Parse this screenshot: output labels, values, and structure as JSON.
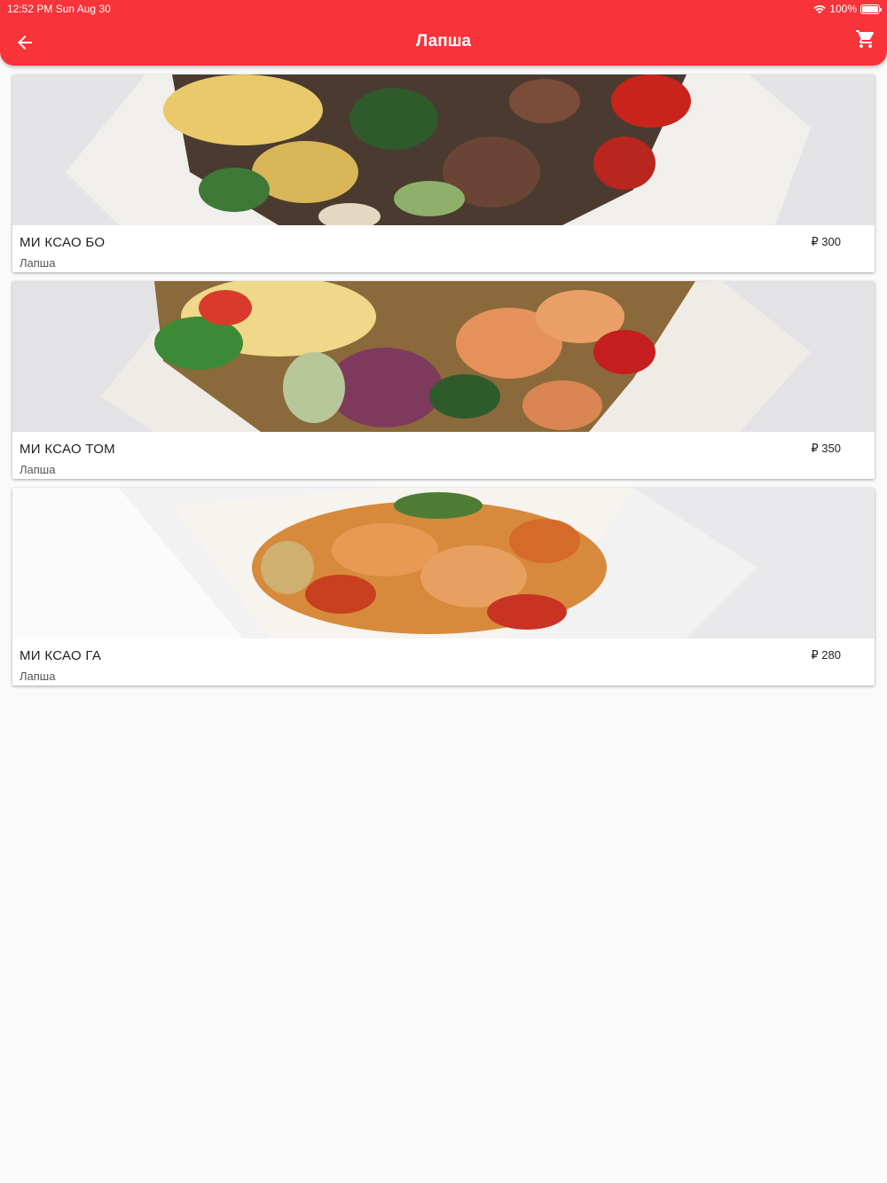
{
  "status_bar": {
    "time": "12:52 PM   Sun Aug 30",
    "battery": "100%"
  },
  "app_bar": {
    "title": "Лапша",
    "back_icon": "arrow-back-icon",
    "cart_icon": "shopping-cart-icon",
    "color": "#f8333a"
  },
  "items": [
    {
      "name": "МИ КСАО БО",
      "category": "Лапша",
      "price": "₽ 300"
    },
    {
      "name": "МИ КСАО ТОМ",
      "category": "Лапша",
      "price": "₽ 350"
    },
    {
      "name": "МИ КСАО ГА",
      "category": "Лапша",
      "price": "₽ 280"
    }
  ]
}
